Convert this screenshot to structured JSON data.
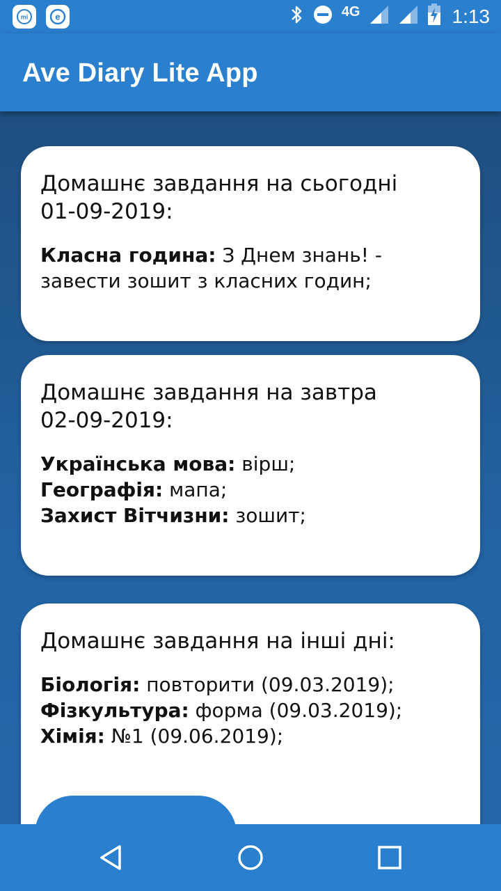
{
  "status_bar": {
    "network_label": "4G",
    "time": "1:13",
    "icons": [
      "mi-icon",
      "e-icon",
      "bluetooth-icon",
      "do-not-disturb-icon",
      "signal-icon",
      "signal-icon",
      "battery-charging-icon"
    ]
  },
  "app_bar": {
    "title": "Ave Diary Lite App"
  },
  "cards": {
    "today": {
      "title_line1": "Домашнє завдання на сьогодні",
      "title_line2": "01-09-2019:",
      "items": [
        {
          "subject": "Класна година:",
          "task": " З Днем знань! - завести зошит з класних годин;"
        }
      ]
    },
    "tomorrow": {
      "title_line1": "Домашнє завдання на завтра",
      "title_line2": "02-09-2019:",
      "items": [
        {
          "subject": "Українська мова:",
          "task": " вірш;"
        },
        {
          "subject": "Географія:",
          "task": " мапа;"
        },
        {
          "subject": "Захист Вітчизни:",
          "task": " зошит;"
        }
      ]
    },
    "other": {
      "title_line1": "Домашнє завдання на інші дні:",
      "items": [
        {
          "subject": "Біологія:",
          "task": " повторити (09.03.2019);"
        },
        {
          "subject": "Фізкультура:",
          "task": " форма (09.03.2019);"
        },
        {
          "subject": "Хімія:",
          "task": " №1 (09.06.2019);"
        }
      ]
    }
  },
  "colors": {
    "primary": "#2a7fcf",
    "background_top": "#1e4e7f",
    "background_bottom": "#2466a8",
    "card": "#ffffff"
  },
  "nav_bar": {
    "icons": [
      "back-icon",
      "home-icon",
      "recents-icon"
    ]
  }
}
